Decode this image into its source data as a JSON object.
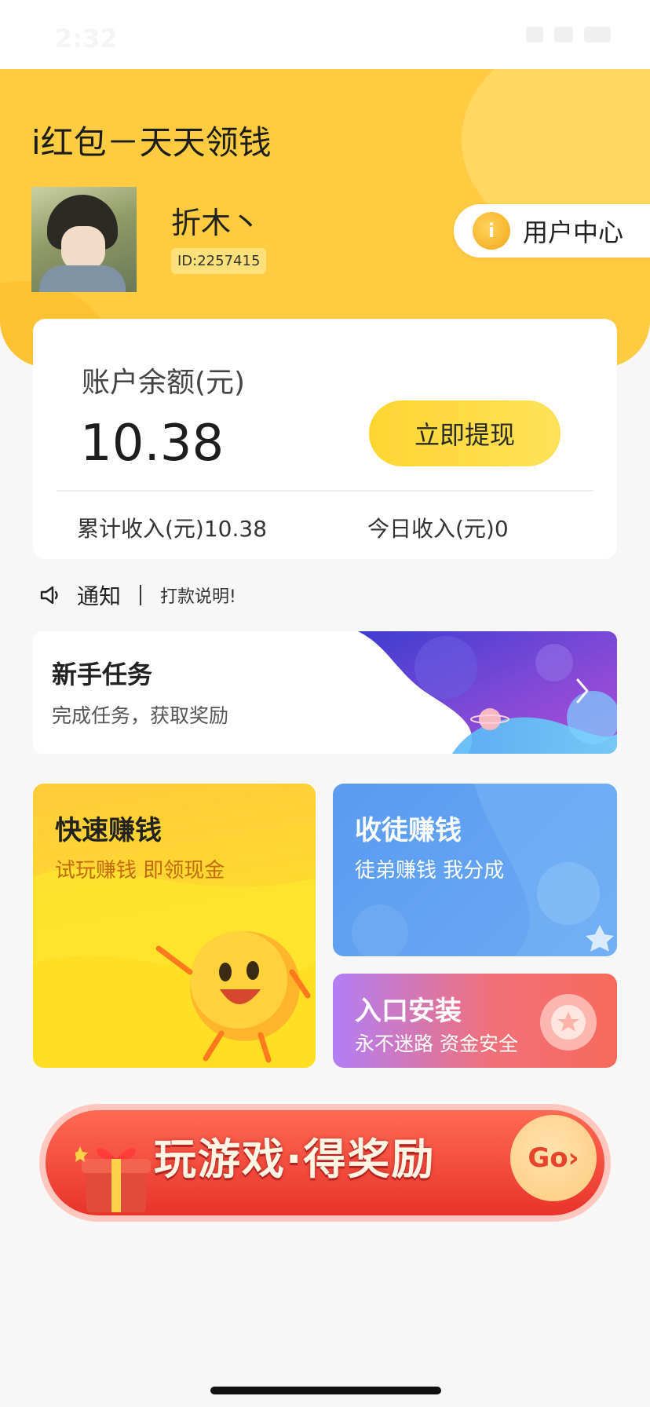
{
  "status_bar": {
    "time": "2:32"
  },
  "header": {
    "app_title": "i红包－天天领钱",
    "username": "折木丶",
    "user_id": "ID:2257415",
    "user_center_label": "用户中心"
  },
  "balance": {
    "title": "账户余额(元)",
    "value": "10.38",
    "withdraw_label": "立即提现",
    "total_income": "累计收入(元)10.38",
    "today_income": "今日收入(元)0"
  },
  "notice": {
    "label": "通知",
    "text": "打款说明!"
  },
  "newbie_task": {
    "title": "新手任务",
    "subtitle": "完成任务，获取奖励"
  },
  "tiles": {
    "quick": {
      "title": "快速赚钱",
      "subtitle": "试玩赚钱 即领现金"
    },
    "recruit": {
      "title": "收徒赚钱",
      "subtitle": "徒弟赚钱 我分成"
    },
    "install": {
      "title": "入口安装",
      "subtitle": "永不迷路 资金安全"
    }
  },
  "game_banner": {
    "text": "玩游戏·得奖励",
    "go_label": "Go›"
  },
  "icons": {
    "speaker": "speaker-icon",
    "arrow": "chevron-right-icon",
    "user_center": "coin-badge-icon"
  },
  "colors": {
    "header_yellow": "#ffcb40",
    "withdraw_button": "#ffd531",
    "recruit_blue": "#5b9bf0",
    "banner_red": "#e9332b",
    "quick_orange_text": "#c46a10"
  }
}
